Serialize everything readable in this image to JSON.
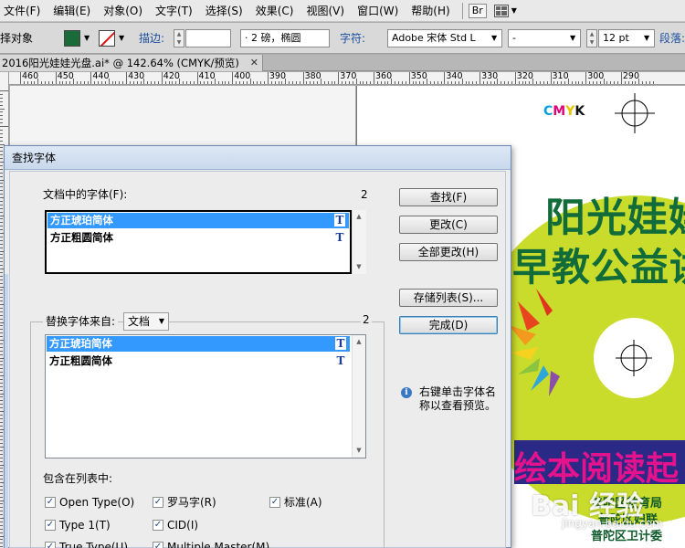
{
  "menubar": {
    "items": [
      "文件(F)",
      "编辑(E)",
      "对象(O)",
      "文字(T)",
      "选择(S)",
      "效果(C)",
      "视图(V)",
      "窗口(W)",
      "帮助(H)"
    ],
    "bridge_label": "Br"
  },
  "controlbar": {
    "selection_label": "择对象",
    "fill_color": "#1a6a3a",
    "stroke_label": "描边:",
    "stroke_weight": "· 2 磅，椭圆",
    "char_label": "字符:",
    "font_name": "Adobe 宋体 Std L",
    "font_style": "-",
    "font_size": "12 pt",
    "para_label": "段落:"
  },
  "document": {
    "tab_title": "2016阳光娃娃光盘.ai* @ 142.64% (CMYK/预览)",
    "close_glyph": "✕"
  },
  "ruler": {
    "top_labels": [
      "460",
      "450",
      "440",
      "430",
      "420",
      "410",
      "400",
      "390",
      "380",
      "370",
      "360",
      "350",
      "340",
      "330",
      "320",
      "310",
      "300",
      "290"
    ]
  },
  "artwork": {
    "cmyk": {
      "c": "C",
      "m": "M",
      "y": "Y",
      "k": "K"
    },
    "title_line1": "阳光娃娃",
    "title_line2": "早教公益讲",
    "banner_text": "绘本阅读起",
    "org_line1": "普陀区教育局",
    "org_line2": "普陀区妇联",
    "org_line3": "普陀区卫计委",
    "watermark_logo": "Bai 经验",
    "watermark_url": "jingyan.baidu.com",
    "disc_color": "#c9dc2b",
    "banner_color": "#2a2a86"
  },
  "dialog": {
    "title": "查找字体",
    "doc_fonts_label": "文档中的字体(F):",
    "doc_fonts_count": "2",
    "doc_fonts": [
      "方正琥珀简体",
      "方正粗圆简体"
    ],
    "replace_label": "替换字体来自:",
    "replace_source": "文档",
    "replace_count": "2",
    "replace_fonts": [
      "方正琥珀简体",
      "方正粗圆简体"
    ],
    "font_type_glyph": "T",
    "buttons": {
      "find": "查找(F)",
      "change": "更改(C)",
      "change_all": "全部更改(H)",
      "save_list": "存储列表(S)...",
      "done": "完成(D)"
    },
    "info_glyph": "i",
    "info_text": "右键单击字体名称以查看预览。",
    "include_label": "包含在列表中:",
    "checkboxes": [
      {
        "label": "Open Type(O)",
        "checked": true
      },
      {
        "label": "罗马字(R)",
        "checked": true
      },
      {
        "label": "标准(A)",
        "checked": true
      },
      {
        "label": "Type 1(T)",
        "checked": true
      },
      {
        "label": "CID(I)",
        "checked": true
      },
      {
        "label": "True Type(U)",
        "checked": true
      },
      {
        "label": "Multiple Master(M)",
        "checked": true
      }
    ],
    "check_glyph": "✓"
  }
}
